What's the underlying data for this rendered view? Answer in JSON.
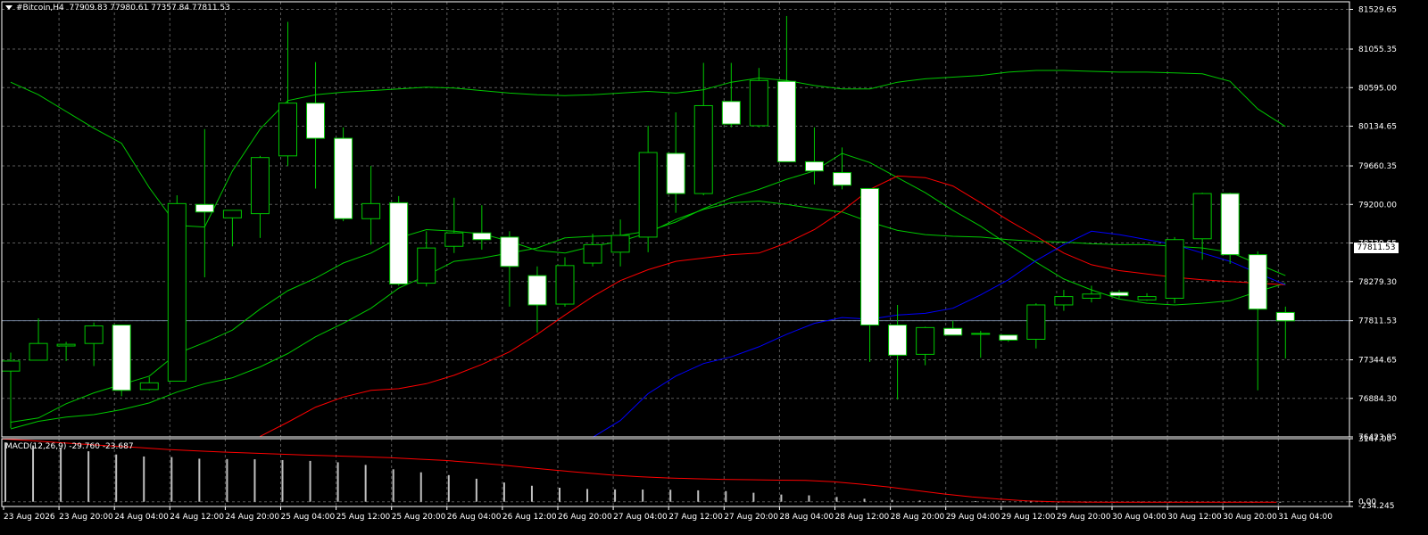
{
  "header": {
    "symbol_label": "#Bitcoin,H4",
    "ohlc": "77909.83 77980.61 77357.84 77811.53",
    "macd_label": "MACD(12,26,9) -29.760 -23.687",
    "current_price_tag": "77811.53"
  },
  "colors": {
    "background": "#000000",
    "grid": "#5a5a5a",
    "bull_candle_body": "#000000",
    "bear_candle_body": "#ffffff",
    "candle_wick": "#00c800",
    "bollinger_line": "#00c800",
    "ma_red": "#ff0000",
    "ma_blue": "#0000ff",
    "macd_histogram": "#c0c0c0",
    "macd_signal": "#ff0000",
    "bid_line": "#6e7d96"
  },
  "chart_data": [
    {
      "type": "candlestick",
      "timeframe": "H4",
      "x_tick_labels": [
        "23 Aug 2026",
        "23 Aug 20:00",
        "24 Aug 04:00",
        "24 Aug 12:00",
        "24 Aug 20:00",
        "25 Aug 04:00",
        "25 Aug 12:00",
        "25 Aug 20:00",
        "26 Aug 04:00",
        "26 Aug 12:00",
        "26 Aug 20:00",
        "27 Aug 04:00",
        "27 Aug 12:00",
        "27 Aug 20:00",
        "28 Aug 04:00",
        "28 Aug 12:00",
        "28 Aug 20:00",
        "29 Aug 04:00",
        "29 Aug 12:00",
        "29 Aug 20:00",
        "30 Aug 04:00",
        "30 Aug 12:00",
        "30 Aug 20:00",
        "31 Aug 04:00"
      ],
      "y_tick_labels": [
        "81529.65",
        "81055.35",
        "80595.00",
        "80134.65",
        "79660.35",
        "79200.00",
        "78739.65",
        "78279.30",
        "77811.53",
        "77344.65",
        "76884.30",
        "76423.95"
      ],
      "ylim": [
        76424,
        81620
      ],
      "candles": [
        {
          "o": 77210,
          "h": 77430,
          "l": 76530,
          "c": 77330
        },
        {
          "o": 77340,
          "h": 77840,
          "l": 77340,
          "c": 77540
        },
        {
          "o": 77510,
          "h": 77560,
          "l": 77330,
          "c": 77530
        },
        {
          "o": 77540,
          "h": 77790,
          "l": 77270,
          "c": 77750
        },
        {
          "o": 77760,
          "h": 77760,
          "l": 76910,
          "c": 76980
        },
        {
          "o": 76990,
          "h": 77140,
          "l": 76980,
          "c": 77070
        },
        {
          "o": 77090,
          "h": 79310,
          "l": 77090,
          "c": 79210
        },
        {
          "o": 79200,
          "h": 80100,
          "l": 78330,
          "c": 79110
        },
        {
          "o": 79040,
          "h": 79120,
          "l": 78700,
          "c": 79130
        },
        {
          "o": 79090,
          "h": 79780,
          "l": 78800,
          "c": 79760
        },
        {
          "o": 79780,
          "h": 81380,
          "l": 79660,
          "c": 80410
        },
        {
          "o": 80410,
          "h": 80900,
          "l": 79390,
          "c": 79990
        },
        {
          "o": 79990,
          "h": 80120,
          "l": 79000,
          "c": 79030
        },
        {
          "o": 79030,
          "h": 79660,
          "l": 78720,
          "c": 79210
        },
        {
          "o": 79220,
          "h": 79300,
          "l": 78230,
          "c": 78250
        },
        {
          "o": 78260,
          "h": 78880,
          "l": 78220,
          "c": 78680
        },
        {
          "o": 78700,
          "h": 79280,
          "l": 78620,
          "c": 78860
        },
        {
          "o": 78860,
          "h": 79190,
          "l": 78660,
          "c": 78780
        },
        {
          "o": 78810,
          "h": 78880,
          "l": 77980,
          "c": 78460
        },
        {
          "o": 78350,
          "h": 78460,
          "l": 77670,
          "c": 78000
        },
        {
          "o": 78010,
          "h": 78570,
          "l": 77980,
          "c": 78470
        },
        {
          "o": 78500,
          "h": 78850,
          "l": 78460,
          "c": 78720
        },
        {
          "o": 78630,
          "h": 79020,
          "l": 78460,
          "c": 78830
        },
        {
          "o": 78810,
          "h": 80140,
          "l": 78630,
          "c": 79820
        },
        {
          "o": 79810,
          "h": 80300,
          "l": 79100,
          "c": 79330
        },
        {
          "o": 79330,
          "h": 80890,
          "l": 79310,
          "c": 80380
        },
        {
          "o": 80430,
          "h": 80890,
          "l": 80120,
          "c": 80160
        },
        {
          "o": 80140,
          "h": 80830,
          "l": 80120,
          "c": 80680
        },
        {
          "o": 80670,
          "h": 81450,
          "l": 80440,
          "c": 79710
        },
        {
          "o": 79710,
          "h": 80120,
          "l": 79440,
          "c": 79600
        },
        {
          "o": 79580,
          "h": 79880,
          "l": 79380,
          "c": 79430
        },
        {
          "o": 79390,
          "h": 79390,
          "l": 77320,
          "c": 77760
        },
        {
          "o": 77760,
          "h": 78000,
          "l": 76870,
          "c": 77400
        },
        {
          "o": 77410,
          "h": 77740,
          "l": 77280,
          "c": 77730
        },
        {
          "o": 77720,
          "h": 77810,
          "l": 77640,
          "c": 77640
        },
        {
          "o": 77660,
          "h": 77690,
          "l": 77370,
          "c": 77660
        },
        {
          "o": 77640,
          "h": 77640,
          "l": 77560,
          "c": 77580
        },
        {
          "o": 77590,
          "h": 78020,
          "l": 77480,
          "c": 78000
        },
        {
          "o": 78000,
          "h": 78180,
          "l": 77930,
          "c": 78100
        },
        {
          "o": 78080,
          "h": 78230,
          "l": 78030,
          "c": 78130
        },
        {
          "o": 78150,
          "h": 78180,
          "l": 78080,
          "c": 78110
        },
        {
          "o": 78060,
          "h": 78140,
          "l": 78050,
          "c": 78100
        },
        {
          "o": 78080,
          "h": 78810,
          "l": 78020,
          "c": 78780
        },
        {
          "o": 78790,
          "h": 79340,
          "l": 78540,
          "c": 79330
        },
        {
          "o": 79330,
          "h": 79340,
          "l": 78490,
          "c": 78600
        },
        {
          "o": 78600,
          "h": 78640,
          "l": 76980,
          "c": 77950
        },
        {
          "o": 77910,
          "h": 77980,
          "l": 77360,
          "c": 77810
        }
      ],
      "indicators": [
        {
          "kind": "bollinger_upper",
          "color": "#00c800",
          "values": [
            80660,
            80510,
            80310,
            80110,
            79930,
            79400,
            78950,
            78930,
            79600,
            80100,
            80440,
            80510,
            80540,
            80560,
            80580,
            80600,
            80590,
            80560,
            80530,
            80510,
            80500,
            80510,
            80530,
            80550,
            80530,
            80570,
            80660,
            80710,
            80680,
            80620,
            80580,
            80580,
            80660,
            80700,
            80720,
            80740,
            80780,
            80800,
            80800,
            80790,
            80780,
            80780,
            80770,
            80760,
            80670,
            80340,
            80130
          ]
        },
        {
          "kind": "bollinger_middle",
          "color": "#00c800",
          "values": [
            76600,
            76650,
            76820,
            76950,
            77050,
            77150,
            77420,
            77550,
            77700,
            77950,
            78170,
            78320,
            78500,
            78620,
            78800,
            78900,
            78880,
            78850,
            78760,
            78650,
            78620,
            78700,
            78760,
            78860,
            79020,
            79140,
            79220,
            79240,
            79200,
            79150,
            79110,
            78990,
            78890,
            78840,
            78820,
            78810,
            78780,
            78760,
            78750,
            78730,
            78720,
            78720,
            78700,
            78680,
            78630,
            78490,
            78350
          ]
        },
        {
          "kind": "bollinger_lower",
          "color": "#00c800",
          "values": [
            76520,
            76610,
            76660,
            76690,
            76750,
            76830,
            76960,
            77060,
            77130,
            77260,
            77420,
            77620,
            77780,
            77960,
            78200,
            78350,
            78520,
            78560,
            78620,
            78680,
            78800,
            78820,
            78830,
            78880,
            78990,
            79150,
            79280,
            79380,
            79500,
            79600,
            79810,
            79700,
            79520,
            79340,
            79130,
            78940,
            78720,
            78510,
            78310,
            78180,
            78070,
            78020,
            78000,
            78020,
            78050,
            78160,
            78260
          ]
        },
        {
          "kind": "ma_red",
          "color": "#ff0000",
          "values": [
            null,
            null,
            null,
            null,
            null,
            null,
            null,
            null,
            null,
            76430,
            76600,
            76780,
            76900,
            76980,
            77000,
            77060,
            77160,
            77290,
            77440,
            77650,
            77880,
            78100,
            78290,
            78420,
            78520,
            78560,
            78600,
            78620,
            78740,
            78900,
            79120,
            79380,
            79540,
            79520,
            79420,
            79220,
            79010,
            78820,
            78620,
            78480,
            78410,
            78370,
            78330,
            78300,
            78280,
            78260,
            78240
          ]
        },
        {
          "kind": "ma_blue",
          "color": "#0000ff",
          "values": [
            null,
            null,
            null,
            null,
            null,
            null,
            null,
            null,
            null,
            null,
            null,
            null,
            null,
            null,
            null,
            null,
            null,
            null,
            null,
            null,
            null,
            76420,
            76620,
            76940,
            77150,
            77300,
            77380,
            77500,
            77650,
            77780,
            77850,
            77830,
            77880,
            77900,
            77960,
            78120,
            78300,
            78530,
            78720,
            78880,
            78840,
            78780,
            78720,
            78620,
            78520,
            78380,
            78240
          ]
        }
      ]
    },
    {
      "type": "bar+line",
      "title": "MACD(12,26,9)",
      "y_tick_labels": [
        "3147.00",
        "0.00",
        "-234.245"
      ],
      "ylim": [
        -234.245,
        3147
      ],
      "histogram": [
        2960,
        2810,
        2680,
        2520,
        2360,
        2260,
        2230,
        2150,
        2130,
        2120,
        2080,
        2040,
        1970,
        1840,
        1620,
        1470,
        1330,
        1150,
        960,
        800,
        700,
        640,
        620,
        610,
        600,
        570,
        530,
        450,
        360,
        320,
        240,
        150,
        90,
        60,
        40,
        30,
        20,
        10,
        5,
        -10,
        -20,
        -25,
        -28,
        -30,
        -30,
        -30,
        -29.76
      ],
      "signal": [
        3140,
        3060,
        2960,
        2870,
        2780,
        2700,
        2610,
        2540,
        2480,
        2430,
        2380,
        2330,
        2290,
        2250,
        2200,
        2130,
        2060,
        1960,
        1840,
        1700,
        1570,
        1450,
        1330,
        1250,
        1190,
        1150,
        1120,
        1100,
        1080,
        1070,
        1000,
        880,
        740,
        560,
        390,
        240,
        130,
        40,
        -5,
        -18,
        -22,
        -24,
        -25,
        -25,
        -24,
        -24,
        -23.687
      ]
    }
  ]
}
